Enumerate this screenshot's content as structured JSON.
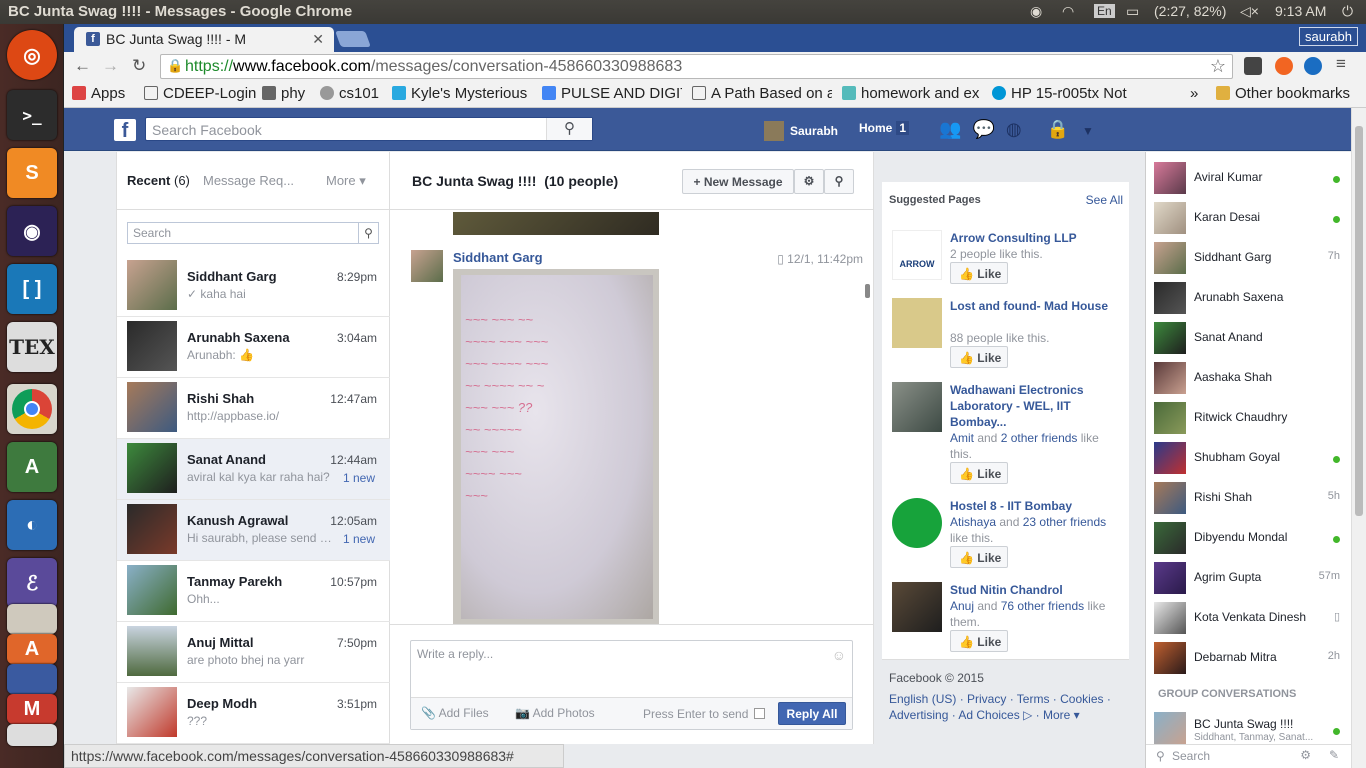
{
  "os": {
    "window_title": "BC Junta Swag !!!! - Messages - Google Chrome",
    "keyboard": "En",
    "battery": "(2:27, 82%)",
    "time": "9:13 AM"
  },
  "launcher": [
    "ubuntu",
    "terminal",
    "sublime",
    "eclipse",
    "bracket",
    "TeX",
    "chrome",
    "android-studio",
    "fish",
    "emacs",
    "files",
    "impress"
  ],
  "browser": {
    "tab_title": "BC Junta Swag !!!! - M",
    "profile": "saurabh",
    "url_scheme": "https://",
    "url_host": "www.facebook.com",
    "url_path": "/messages/conversation-458660330988683",
    "bookmarks": [
      "Apps",
      "CDEEP-Login",
      "phy",
      "cs101",
      "Kyle's Mysterious",
      "PULSE AND DIGIT",
      "A Path Based on a",
      "homework and ex",
      "HP 15-r005tx Not",
      "»",
      "Other bookmarks"
    ],
    "status_url": "https://www.facebook.com/messages/conversation-458660330988683#"
  },
  "fb": {
    "search_placeholder": "Search Facebook",
    "user": "Saurabh",
    "home": "Home",
    "home_count": "1"
  },
  "inbox": {
    "tab_recent": "Recent",
    "recent_count": "(6)",
    "tab_requests": "Message Req...",
    "tab_more": "More",
    "search_placeholder": "Search",
    "conversations": [
      {
        "name": "Siddhant Garg",
        "time": "8:29pm",
        "snippet": "✓ kaha hai",
        "new": ""
      },
      {
        "name": "Arunabh Saxena",
        "time": "3:04am",
        "snippet": "Arunabh: 👍",
        "new": ""
      },
      {
        "name": "Rishi Shah",
        "time": "12:47am",
        "snippet": "http://appbase.io/",
        "new": ""
      },
      {
        "name": "Sanat Anand",
        "time": "12:44am",
        "snippet": "aviral kal kya kar raha hai?",
        "new": "1 new"
      },
      {
        "name": "Kanush Agrawal",
        "time": "12:05am",
        "snippet": "Hi saurabh, please send m...",
        "new": "1 new"
      },
      {
        "name": "Tanmay Parekh",
        "time": "10:57pm",
        "snippet": "Ohh...",
        "new": ""
      },
      {
        "name": "Anuj Mittal",
        "time": "7:50pm",
        "snippet": "are photo bhej na yarr",
        "new": ""
      },
      {
        "name": "Deep Modh",
        "time": "3:51pm",
        "snippet": "???",
        "new": ""
      }
    ]
  },
  "thread": {
    "title": "BC Junta Swag !!!!",
    "people": "(10 people)",
    "new_message": "New Message",
    "sender": "Siddhant Garg",
    "timestamp": "12/1, 11:42pm",
    "reply_placeholder": "Write a reply...",
    "add_files": "Add Files",
    "add_photos": "Add Photos",
    "press_enter": "Press Enter to send",
    "reply_all": "Reply All"
  },
  "suggested": {
    "heading": "Suggested Pages",
    "see_all": "See All",
    "like_label": "Like",
    "pages": [
      {
        "title": "Arrow Consulting LLP",
        "desc": "2 people like this.",
        "color": "#ffffff"
      },
      {
        "title": "Lost and found- Mad House",
        "desc": "88 people like this.",
        "color": "#d9c98a"
      },
      {
        "title": "Wadhawani Electronics Laboratory - WEL, IIT Bombay...",
        "desc_link1": "Amit",
        "desc_mid": " and ",
        "desc_link2": "2 other friends",
        "desc_end": " like this.",
        "color": "#6f7670"
      },
      {
        "title": "Hostel 8 - IIT Bombay",
        "desc_link1": "Atishaya",
        "desc_mid": " and ",
        "desc_link2": "23 other friends",
        "desc_end": " like this.",
        "color": "#17a33b"
      },
      {
        "title": "Stud Nitin Chandrol",
        "desc_link1": "Anuj",
        "desc_mid": " and ",
        "desc_link2": "76 other friends",
        "desc_end": " like them.",
        "color": "#3b3a36"
      }
    ],
    "footer_copy": "Facebook © 2015",
    "footer_links": "English (US) · Privacy · Terms · Cookies · Advertising · Ad Choices ▷ · More ▾"
  },
  "chat": {
    "friends": [
      {
        "name": "Aviral Kumar",
        "status": "online"
      },
      {
        "name": "Karan Desai",
        "status": "online"
      },
      {
        "name": "Siddhant Garg",
        "status": "7h"
      },
      {
        "name": "Arunabh Saxena",
        "status": ""
      },
      {
        "name": "Sanat Anand",
        "status": ""
      },
      {
        "name": "Aashaka Shah",
        "status": ""
      },
      {
        "name": "Ritwick Chaudhry",
        "status": ""
      },
      {
        "name": "Shubham Goyal",
        "status": "online"
      },
      {
        "name": "Rishi Shah",
        "status": "5h"
      },
      {
        "name": "Dibyendu Mondal",
        "status": "online"
      },
      {
        "name": "Agrim Gupta",
        "status": "57m"
      },
      {
        "name": "Kota Venkata Dinesh",
        "status": "mobile"
      },
      {
        "name": "Debarnab Mitra",
        "status": "2h"
      }
    ],
    "group_heading": "GROUP CONVERSATIONS",
    "group_name": "BC Junta Swag !!!!",
    "group_members": "Siddhant, Tanmay, Sanat...",
    "search_placeholder": "Search"
  },
  "colors": {
    "fb_blue": "#3b5998",
    "link": "#365899",
    "online": "#42b72a"
  }
}
